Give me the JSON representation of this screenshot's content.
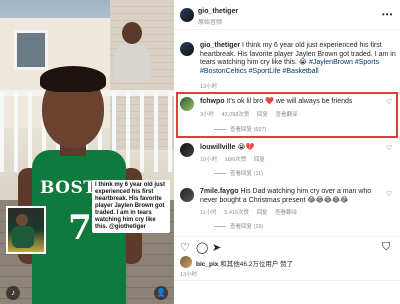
{
  "photo": {
    "jersey_text": "BOSTON",
    "jersey_number": "7",
    "caption_overlay": "I think my 6 year old just experienced his first heartbreak. His favorite player Jaylen Brown got traded. I am in tears watching him cry like this.",
    "caption_tag": "@giothetiger"
  },
  "post_header": {
    "username": "gio_thetiger",
    "subline": "原始音频"
  },
  "caption": {
    "username": "gio_thetiger",
    "text": "I think my 6 year old just experienced his first heartbreak. His favorite player Jaylen Brown got traded. I am in tears watching him cry like this. 😭 ",
    "hashtags": "#JaylenBrown #Sports #BostonCeltics #SportLife #Basketball",
    "time": "13小时"
  },
  "comments": [
    {
      "username": "fchwpo",
      "text": "It's ok lil bro ❤️ we will always be friends",
      "time": "3小时",
      "likes": "43,098次赞",
      "reply": "回复",
      "translate": "查看翻译",
      "view_replies": "查看回复 (697)"
    },
    {
      "username": "louwillville",
      "text": "😭💔",
      "time": "10小时",
      "likes": "18/6次赞",
      "reply": "回复",
      "view_replies": "查看回复 (11)"
    },
    {
      "username": "7mile.faygo",
      "text": "His Dad watching him cry over a man who never bought a Christmas present 😂😂😂😂😂",
      "time": "11小时",
      "likes": "3,416次赞",
      "reply": "回复",
      "translate": "查看翻译",
      "view_replies": "查看回复 (19)"
    }
  ],
  "likes_line": {
    "user": "bic_pix",
    "rest": "和其他46.2万位用户 赞了"
  },
  "date": "13小时",
  "colors": {
    "highlight": "#e33b3b",
    "hashtag": "#00376b",
    "jersey": "#0f7a3e"
  },
  "icons": [
    "heart-icon",
    "comment-icon",
    "share-icon",
    "bookmark-icon",
    "more-icon",
    "audio-icon",
    "tag-icon"
  ]
}
